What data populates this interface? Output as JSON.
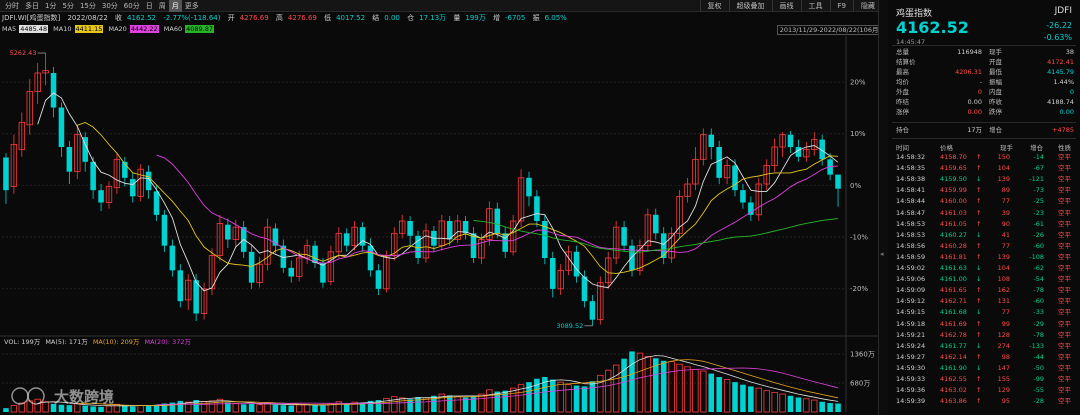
{
  "toolbar": {
    "periods": [
      "分时",
      "多日",
      "1分",
      "5分",
      "15分",
      "30分",
      "60分",
      "日",
      "周",
      "月",
      "更多"
    ],
    "active_period": "月",
    "right_buttons": [
      "复权",
      "超级叠加",
      "画线",
      "工具",
      "F9",
      "隐藏"
    ]
  },
  "info": {
    "name": "JDFI.WI[鸡蛋指数]",
    "date": "2022/08/22",
    "close_label": "收",
    "close": "4162.52",
    "change": "-2.77%(-118.64)",
    "open_label": "开",
    "open": "4276.69",
    "high_label": "高",
    "high": "4276.69",
    "low_label": "低",
    "low": "4017.52",
    "settle_label": "结",
    "settle": "0.00",
    "vol_label": "仓",
    "vol": "17.13万",
    "amt_label": "量",
    "amt": "199万",
    "inc_label": "增",
    "inc": "-6705",
    "amp_label": "振",
    "amp": "6.05%"
  },
  "ma_bar": {
    "ma5": "MA5",
    "ma5_val": "4485.48",
    "ma10": "MA10",
    "ma10_val": "4411.15",
    "ma20": "MA20",
    "ma20_val": "4442.22",
    "ma60": "MA60",
    "ma60_val": "4089.87"
  },
  "range_label": "2013/11/29-2022/08/22(106月)",
  "vol_bar": {
    "vol": "VOL: 199万",
    "ma5": "MA(5): 171万",
    "ma10": "MA(10): 209万",
    "ma20": "MA(20): 372万"
  },
  "watermark": "大数跨境",
  "colors": {
    "up": "#ff3b3b",
    "down": "#00d2d2",
    "ma5": "#e0e0e0",
    "ma10": "#e6c619",
    "ma20": "#e040e0",
    "ma60": "#28b428"
  },
  "chart_data": {
    "type": "candlestick",
    "pct_ticks": [
      "20%",
      "10%",
      "0%",
      "-10%",
      "-20%"
    ],
    "vol_ticks": [
      "1360万",
      "680万"
    ],
    "high_annotation": "5262.43",
    "low_annotation": "3089.52",
    "candles": [
      [
        4415,
        4150,
        4450,
        4040
      ],
      [
        4180,
        4520,
        4600,
        4120
      ],
      [
        4480,
        4700,
        4780,
        4420
      ],
      [
        4680,
        4950,
        5050,
        4600
      ],
      [
        4950,
        5100,
        5180,
        4850
      ],
      [
        5100,
        5120,
        5262,
        5000
      ],
      [
        5100,
        4820,
        5150,
        4740
      ],
      [
        4820,
        4500,
        4860,
        4420
      ],
      [
        4500,
        4300,
        4550,
        4200
      ],
      [
        4300,
        4600,
        4680,
        4240
      ],
      [
        4580,
        4380,
        4620,
        4300
      ],
      [
        4380,
        4150,
        4420,
        4080
      ],
      [
        4150,
        4050,
        4200,
        3980
      ],
      [
        4050,
        4180,
        4220,
        4000
      ],
      [
        4170,
        4400,
        4450,
        4120
      ],
      [
        4380,
        4250,
        4420,
        4180
      ],
      [
        4240,
        4100,
        4290,
        4050
      ],
      [
        4100,
        4320,
        4360,
        4060
      ],
      [
        4300,
        4150,
        4350,
        4080
      ],
      [
        4140,
        3950,
        4190,
        3900
      ],
      [
        3950,
        3700,
        3990,
        3650
      ],
      [
        3700,
        3500,
        3750,
        3450
      ],
      [
        3500,
        3250,
        3550,
        3200
      ],
      [
        3260,
        3420,
        3470,
        3180
      ],
      [
        3420,
        3150,
        3470,
        3089
      ],
      [
        3150,
        3350,
        3400,
        3100
      ],
      [
        3350,
        3620,
        3680,
        3300
      ],
      [
        3620,
        3880,
        3950,
        3580
      ],
      [
        3870,
        3750,
        3920,
        3680
      ],
      [
        3750,
        3850,
        3910,
        3690
      ],
      [
        3850,
        3650,
        3900,
        3600
      ],
      [
        3650,
        3400,
        3700,
        3350
      ],
      [
        3400,
        3550,
        3610,
        3360
      ],
      [
        3550,
        3850,
        3920,
        3500
      ],
      [
        3840,
        3700,
        3880,
        3640
      ],
      [
        3700,
        3520,
        3750,
        3480
      ],
      [
        3520,
        3450,
        3580,
        3400
      ],
      [
        3450,
        3600,
        3660,
        3410
      ],
      [
        3600,
        3700,
        3750,
        3550
      ],
      [
        3700,
        3560,
        3740,
        3520
      ],
      [
        3560,
        3400,
        3600,
        3360
      ],
      [
        3410,
        3650,
        3700,
        3380
      ],
      [
        3650,
        3800,
        3850,
        3600
      ],
      [
        3800,
        3700,
        3840,
        3650
      ],
      [
        3700,
        3850,
        3900,
        3660
      ],
      [
        3850,
        3700,
        3890,
        3650
      ],
      [
        3700,
        3500,
        3760,
        3450
      ],
      [
        3500,
        3350,
        3550,
        3300
      ],
      [
        3350,
        3620,
        3660,
        3320
      ],
      [
        3620,
        3800,
        3850,
        3580
      ],
      [
        3800,
        3900,
        3950,
        3760
      ],
      [
        3900,
        3780,
        3940,
        3700
      ],
      [
        3780,
        3600,
        3820,
        3550
      ],
      [
        3600,
        3820,
        3880,
        3560
      ],
      [
        3820,
        3700,
        3860,
        3650
      ],
      [
        3700,
        3900,
        3950,
        3660
      ],
      [
        3900,
        3750,
        3940,
        3700
      ],
      [
        3750,
        3900,
        3950,
        3720
      ],
      [
        3900,
        3800,
        3940,
        3750
      ],
      [
        3800,
        3600,
        3850,
        3560
      ],
      [
        3600,
        3750,
        3800,
        3550
      ],
      [
        3750,
        4000,
        4060,
        3700
      ],
      [
        4000,
        3800,
        4050,
        3760
      ],
      [
        3800,
        3650,
        3850,
        3600
      ],
      [
        3650,
        3900,
        3950,
        3620
      ],
      [
        3900,
        4250,
        4320,
        3850
      ],
      [
        4250,
        4100,
        4300,
        4020
      ],
      [
        4100,
        3900,
        4150,
        3850
      ],
      [
        3900,
        3600,
        3950,
        3550
      ],
      [
        3600,
        3350,
        3650,
        3280
      ],
      [
        3350,
        3500,
        3550,
        3300
      ],
      [
        3500,
        3650,
        3700,
        3460
      ],
      [
        3650,
        3450,
        3700,
        3400
      ],
      [
        3450,
        3250,
        3500,
        3200
      ],
      [
        3250,
        3100,
        3300,
        3050
      ],
      [
        3100,
        3400,
        3450,
        3060
      ],
      [
        3400,
        3600,
        3650,
        3350
      ],
      [
        3600,
        3850,
        3900,
        3550
      ],
      [
        3850,
        3700,
        3900,
        3650
      ],
      [
        3700,
        3500,
        3750,
        3450
      ],
      [
        3500,
        3700,
        3750,
        3460
      ],
      [
        3700,
        3950,
        4000,
        3650
      ],
      [
        3950,
        3800,
        4000,
        3750
      ],
      [
        3800,
        3600,
        3850,
        3550
      ],
      [
        3600,
        3800,
        3850,
        3560
      ],
      [
        3800,
        4100,
        4150,
        3760
      ],
      [
        4100,
        4200,
        4250,
        4050
      ],
      [
        4200,
        4400,
        4500,
        4150
      ],
      [
        4400,
        4600,
        4650,
        4350
      ],
      [
        4600,
        4500,
        4650,
        4400
      ],
      [
        4500,
        4250,
        4550,
        4200
      ],
      [
        4250,
        4350,
        4400,
        4200
      ],
      [
        4350,
        4150,
        4400,
        4100
      ],
      [
        4150,
        4050,
        4200,
        4000
      ],
      [
        4050,
        3950,
        4100,
        3900
      ],
      [
        3950,
        4200,
        4250,
        3900
      ],
      [
        4200,
        4350,
        4400,
        4150
      ],
      [
        4350,
        4500,
        4570,
        4300
      ],
      [
        4500,
        4600,
        4620,
        4420
      ],
      [
        4600,
        4500,
        4630,
        4450
      ],
      [
        4500,
        4420,
        4560,
        4380
      ],
      [
        4420,
        4480,
        4540,
        4380
      ],
      [
        4480,
        4560,
        4620,
        4430
      ],
      [
        4560,
        4400,
        4600,
        4350
      ],
      [
        4400,
        4276,
        4450,
        4230
      ],
      [
        4276,
        4162,
        4276,
        4017
      ]
    ],
    "volumes": [
      90,
      150,
      210,
      260,
      300,
      240,
      190,
      170,
      160,
      200,
      150,
      130,
      120,
      140,
      180,
      160,
      130,
      150,
      140,
      170,
      200,
      220,
      260,
      230,
      280,
      240,
      260,
      300,
      220,
      200,
      180,
      190,
      170,
      210,
      170,
      160,
      150,
      170,
      180,
      160,
      150,
      200,
      240,
      190,
      230,
      210,
      260,
      280,
      320,
      360,
      330,
      300,
      350,
      330,
      380,
      420,
      390,
      360,
      340,
      380,
      420,
      520,
      480,
      500,
      560,
      640,
      700,
      780,
      820,
      760,
      700,
      640,
      620,
      600,
      720,
      860,
      980,
      1100,
      1250,
      1420,
      1380,
      1300,
      1260,
      1200,
      1180,
      1120,
      1060,
      1000,
      960,
      900,
      820,
      760,
      700,
      640,
      600,
      560,
      500,
      460,
      420,
      380,
      340,
      310,
      280,
      240,
      210,
      199
    ]
  },
  "quote": {
    "title": "鸡蛋指数",
    "code": "JDFI",
    "price": "4162.52",
    "change": "-26.22",
    "change_pct": "-0.63%",
    "time": "14:45:47",
    "rows": [
      {
        "l1": "总量",
        "v1": "116948",
        "l2": "现手",
        "v2": "38"
      },
      {
        "l1": "结算价",
        "v1": "",
        "l2": "开盘",
        "v2": "4172.41"
      },
      {
        "l1": "最高",
        "v1": "4206.31",
        "l2": "最低",
        "v2": "4145.79"
      },
      {
        "l1": "均价",
        "v1": "-",
        "l2": "振幅",
        "v2": "1.44%"
      },
      {
        "l1": "外盘",
        "v1": "0",
        "l2": "内盘",
        "v2": "0"
      },
      {
        "l1": "昨结",
        "v1": "0.00",
        "l2": "昨收",
        "v2": "4188.74"
      },
      {
        "l1": "涨停",
        "v1": "0.00",
        "l2": "跌停",
        "v2": "0.00"
      }
    ],
    "pos_label": "持仓",
    "pos_value": "17万",
    "inc_label": "增仓",
    "inc_value": "+4785"
  },
  "ticks_header": {
    "time": "时间",
    "price": "价格",
    "hand": "现手",
    "inc": "增仓",
    "nature": "性质"
  },
  "ticks": [
    {
      "t": "14:58:32",
      "p": "4158.70",
      "d": "up",
      "h": "150",
      "i": "-14",
      "n": "空平"
    },
    {
      "t": "14:58:35",
      "p": "4159.65",
      "d": "up",
      "h": "104",
      "i": "-67",
      "n": "空平"
    },
    {
      "t": "14:58:38",
      "p": "4159.50",
      "d": "dn",
      "h": "139",
      "i": "-121",
      "n": "空平"
    },
    {
      "t": "14:58:41",
      "p": "4159.99",
      "d": "up",
      "h": "89",
      "i": "-73",
      "n": "空平"
    },
    {
      "t": "14:58:44",
      "p": "4160.00",
      "d": "up",
      "h": "77",
      "i": "-25",
      "n": "空平"
    },
    {
      "t": "14:58:47",
      "p": "4161.03",
      "d": "up",
      "h": "39",
      "i": "-23",
      "n": "空平"
    },
    {
      "t": "14:58:53",
      "p": "4161.05",
      "d": "up",
      "h": "90",
      "i": "-61",
      "n": "空平"
    },
    {
      "t": "14:58:53",
      "p": "4160.27",
      "d": "dn",
      "h": "41",
      "i": "-26",
      "n": "空平"
    },
    {
      "t": "14:58:56",
      "p": "4160.28",
      "d": "up",
      "h": "77",
      "i": "-60",
      "n": "空平"
    },
    {
      "t": "14:58:59",
      "p": "4161.81",
      "d": "up",
      "h": "139",
      "i": "-108",
      "n": "空平"
    },
    {
      "t": "14:59:02",
      "p": "4161.63",
      "d": "dn",
      "h": "104",
      "i": "-62",
      "n": "空平"
    },
    {
      "t": "14:59:06",
      "p": "4161.00",
      "d": "dn",
      "h": "108",
      "i": "-54",
      "n": "空平"
    },
    {
      "t": "14:59:09",
      "p": "4161.65",
      "d": "up",
      "h": "162",
      "i": "-78",
      "n": "空平"
    },
    {
      "t": "14:59:12",
      "p": "4162.71",
      "d": "up",
      "h": "131",
      "i": "-60",
      "n": "空平"
    },
    {
      "t": "14:59:15",
      "p": "4161.68",
      "d": "dn",
      "h": "77",
      "i": "-33",
      "n": "空平"
    },
    {
      "t": "14:59:18",
      "p": "4161.69",
      "d": "up",
      "h": "99",
      "i": "-29",
      "n": "空平"
    },
    {
      "t": "14:59:21",
      "p": "4162.78",
      "d": "up",
      "h": "128",
      "i": "-78",
      "n": "空平"
    },
    {
      "t": "14:59:24",
      "p": "4161.77",
      "d": "dn",
      "h": "274",
      "i": "-133",
      "n": "空平"
    },
    {
      "t": "14:59:27",
      "p": "4162.14",
      "d": "up",
      "h": "98",
      "i": "-44",
      "n": "空平"
    },
    {
      "t": "14:59:30",
      "p": "4161.90",
      "d": "dn",
      "h": "147",
      "i": "-50",
      "n": "空平"
    },
    {
      "t": "14:59:33",
      "p": "4162.55",
      "d": "up",
      "h": "155",
      "i": "-99",
      "n": "空平"
    },
    {
      "t": "14:59:36",
      "p": "4163.02",
      "d": "up",
      "h": "129",
      "i": "-55",
      "n": "空平"
    },
    {
      "t": "14:59:39",
      "p": "4163.86",
      "d": "up",
      "h": "95",
      "i": "-28",
      "n": "空平"
    }
  ]
}
